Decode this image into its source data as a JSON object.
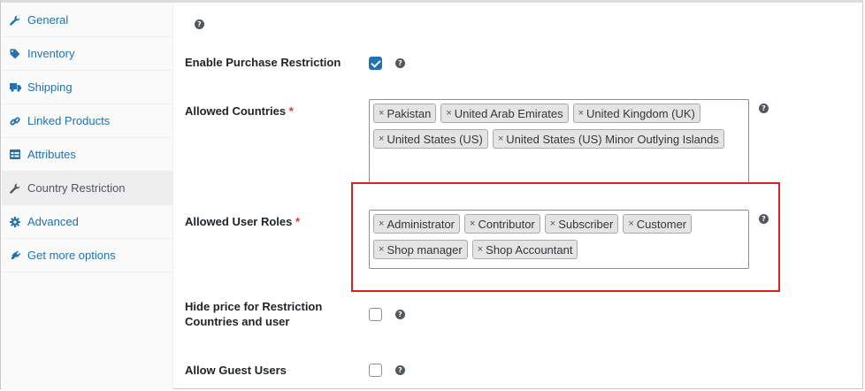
{
  "sidebar": {
    "items": [
      {
        "label": "General",
        "icon": "wrench-icon",
        "active": false
      },
      {
        "label": "Inventory",
        "icon": "tag-icon",
        "active": false
      },
      {
        "label": "Shipping",
        "icon": "truck-icon",
        "active": false
      },
      {
        "label": "Linked Products",
        "icon": "link-icon",
        "active": false
      },
      {
        "label": "Attributes",
        "icon": "table-icon",
        "active": false
      },
      {
        "label": "Country Restriction",
        "icon": "wrench-icon",
        "active": true
      },
      {
        "label": "Advanced",
        "icon": "gear-icon",
        "active": false
      },
      {
        "label": "Get more options",
        "icon": "plugin-icon",
        "active": false
      }
    ]
  },
  "help_glyph": "?",
  "chip_remove_glyph": "×",
  "fields": {
    "enable_purchase_restriction": {
      "label": "Enable Purchase Restriction",
      "checked": true
    },
    "allowed_countries": {
      "label": "Allowed Countries",
      "required_mark": "*",
      "values": [
        "Pakistan",
        "United Arab Emirates",
        "United Kingdom (UK)",
        "United States (US)",
        "United States (US) Minor Outlying Islands"
      ]
    },
    "allowed_user_roles": {
      "label": "Allowed User Roles",
      "required_mark": "*",
      "values": [
        "Administrator",
        "Contributor",
        "Subscriber",
        "Customer",
        "Shop manager",
        "Shop Accountant"
      ]
    },
    "hide_price": {
      "label": "Hide price for Restriction Countries and user",
      "checked": false
    },
    "allow_guest_users": {
      "label": "Allow Guest Users",
      "checked": false
    }
  },
  "colors": {
    "link": "#2271b1",
    "checkbox_checked": "#2271b1",
    "highlight": "#e02020",
    "required": "#d63638"
  }
}
